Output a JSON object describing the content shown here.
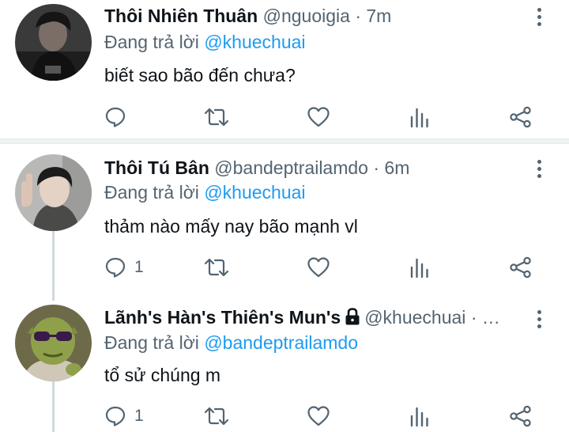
{
  "tweets": [
    {
      "name": "Thôi Nhiên Thuân",
      "handle": "@nguoigia",
      "dot": "·",
      "time": "7m",
      "reply_prefix": "Đang trả lời",
      "reply_to": "@khuechuai",
      "text": "biết sao bão đến chưa?",
      "reply_count": ""
    },
    {
      "name": "Thôi Tú Bân",
      "handle": "@bandeptrailamdo",
      "dot": "·",
      "time": "6m",
      "reply_prefix": "Đang trả lời",
      "reply_to": "@khuechuai",
      "text": "thảm nào mấy nay bão mạnh vl",
      "reply_count": "1"
    },
    {
      "name": "Lãnh's Hàn's Thiên's Mun's",
      "handle": "@khuechuai",
      "dot": "·",
      "time": "…",
      "reply_prefix": "Đang trả lời",
      "reply_to": "@bandeptrailamdo",
      "text": "tổ sử chúng m",
      "reply_count": "1",
      "locked": true
    }
  ],
  "colors": {
    "accent": "#1d9bf0",
    "secondary_text": "#536471",
    "primary_text": "#0f1419",
    "separator": "#eff3f4"
  },
  "icons": [
    "reply-icon",
    "retweet-icon",
    "like-icon",
    "views-icon",
    "share-icon",
    "more-icon",
    "lock-icon"
  ]
}
